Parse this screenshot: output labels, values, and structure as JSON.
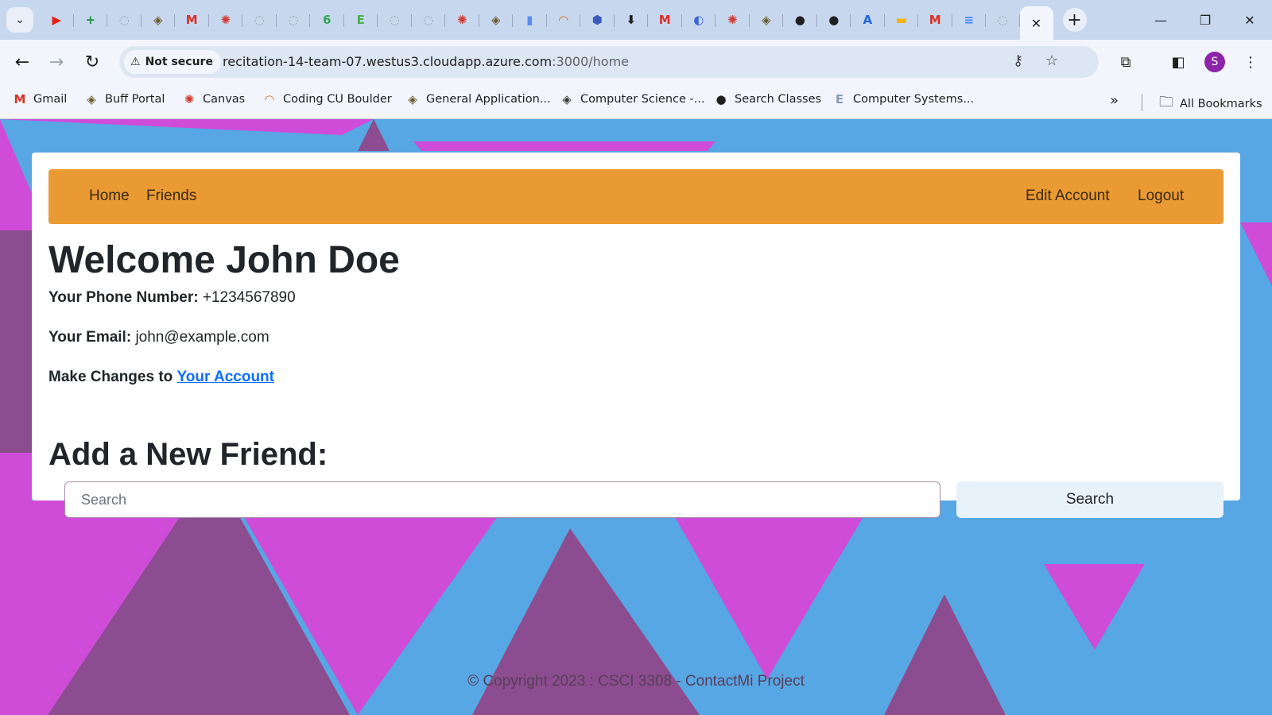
{
  "browser": {
    "tabs": [
      {
        "icon": "youtube-icon",
        "glyph": "▶",
        "color": "#e62117"
      },
      {
        "icon": "google-sheets-icon",
        "glyph": "+",
        "color": "#1e8e3e"
      },
      {
        "icon": "globe-icon",
        "glyph": "◌",
        "color": "#9aa0a6"
      },
      {
        "icon": "cu-buffalo-icon",
        "glyph": "◈",
        "color": "#6b5a2e"
      },
      {
        "icon": "gmail-icon",
        "glyph": "M",
        "color": "#d93025"
      },
      {
        "icon": "canvas-icon",
        "glyph": "✺",
        "color": "#d13b2f"
      },
      {
        "icon": "globe-icon",
        "glyph": "◌",
        "color": "#9aa0a6"
      },
      {
        "icon": "globe-icon",
        "glyph": "◌",
        "color": "#9aa0a6"
      },
      {
        "icon": "leaf-icon",
        "glyph": "6",
        "color": "#34a853"
      },
      {
        "icon": "edstem-icon",
        "glyph": "E",
        "color": "#4caf50"
      },
      {
        "icon": "globe-icon",
        "glyph": "◌",
        "color": "#9aa0a6"
      },
      {
        "icon": "globe-icon",
        "glyph": "◌",
        "color": "#9aa0a6"
      },
      {
        "icon": "canvas-icon",
        "glyph": "✺",
        "color": "#d13b2f"
      },
      {
        "icon": "cu-buffalo-icon",
        "glyph": "◈",
        "color": "#6b5a2e"
      },
      {
        "icon": "bar-chart-icon",
        "glyph": "▮",
        "color": "#5b8def"
      },
      {
        "icon": "coding-cu-icon",
        "glyph": "◠",
        "color": "#e8711a"
      },
      {
        "icon": "cube-icon",
        "glyph": "⬢",
        "color": "#3c5bbf"
      },
      {
        "icon": "download-icon",
        "glyph": "⬇",
        "color": "#1f1f1f"
      },
      {
        "icon": "gmail-icon",
        "glyph": "M",
        "color": "#d93025"
      },
      {
        "icon": "shield-lock-icon",
        "glyph": "◐",
        "color": "#3c66d6"
      },
      {
        "icon": "canvas-icon",
        "glyph": "✺",
        "color": "#d13b2f"
      },
      {
        "icon": "cu-buffalo-icon",
        "glyph": "◈",
        "color": "#6b5a2e"
      },
      {
        "icon": "github-icon",
        "glyph": "●",
        "color": "#1f1f1f"
      },
      {
        "icon": "github-icon",
        "glyph": "●",
        "color": "#1f1f1f"
      },
      {
        "icon": "azure-icon",
        "glyph": "A",
        "color": "#2566d8"
      },
      {
        "icon": "google-slides-icon",
        "glyph": "▬",
        "color": "#f4b400"
      },
      {
        "icon": "gmail-icon",
        "glyph": "M",
        "color": "#d93025"
      },
      {
        "icon": "google-docs-icon",
        "glyph": "≡",
        "color": "#4285f4"
      },
      {
        "icon": "globe-icon",
        "glyph": "◌",
        "color": "#9aa0a6"
      }
    ],
    "active_tab_close": "✕",
    "new_tab": "+",
    "security_label": "Not secure",
    "url_host": "recitation-14-team-07.westus3.cloudapp.azure.com",
    "url_rest": ":3000/home",
    "profile_initial": "S",
    "bookmarks": [
      {
        "label": "Gmail",
        "icon": "gmail-icon",
        "glyph": "M",
        "color": "#d93025"
      },
      {
        "label": "Buff Portal",
        "icon": "cu-buffalo-icon",
        "glyph": "◈",
        "color": "#6b5a2e"
      },
      {
        "label": "Canvas",
        "icon": "canvas-icon",
        "glyph": "✺",
        "color": "#d13b2f"
      },
      {
        "label": "Coding CU Boulder",
        "icon": "coding-cu-icon",
        "glyph": "◠",
        "color": "#e8711a"
      },
      {
        "label": "General Application...",
        "icon": "cu-buffalo-icon",
        "glyph": "◈",
        "color": "#6b5a2e"
      },
      {
        "label": "Computer Science -...",
        "icon": "cu-buffalo-icon",
        "glyph": "◈",
        "color": "#3a3a3a"
      },
      {
        "label": "Search Classes",
        "icon": "globe-icon",
        "glyph": "●",
        "color": "#1f1f1f"
      },
      {
        "label": "Computer Systems...",
        "icon": "edstem-icon",
        "glyph": "E",
        "color": "#8a9bb3"
      }
    ],
    "all_bookmarks": "All Bookmarks"
  },
  "page": {
    "nav": {
      "home": "Home",
      "friends": "Friends",
      "edit_account": "Edit Account",
      "logout": "Logout"
    },
    "welcome": "Welcome John Doe",
    "phone_label": "Your Phone Number:",
    "phone_value": "+1234567890",
    "email_label": "Your Email:",
    "email_value": "john@example.com",
    "changes_label": "Make Changes to",
    "changes_link": "Your Account",
    "add_friend_heading": "Add a New Friend:",
    "search_placeholder": "Search",
    "search_button": "Search",
    "footer": "© Copyright 2023 : CSCI 3308 - ContactMi Project"
  },
  "colors": {
    "background": "#56a7e3",
    "triangle_pink": "#cf4cd9",
    "triangle_purple": "#8b4d8f",
    "navbar": "#ea9a33",
    "link": "#0d6efd"
  }
}
